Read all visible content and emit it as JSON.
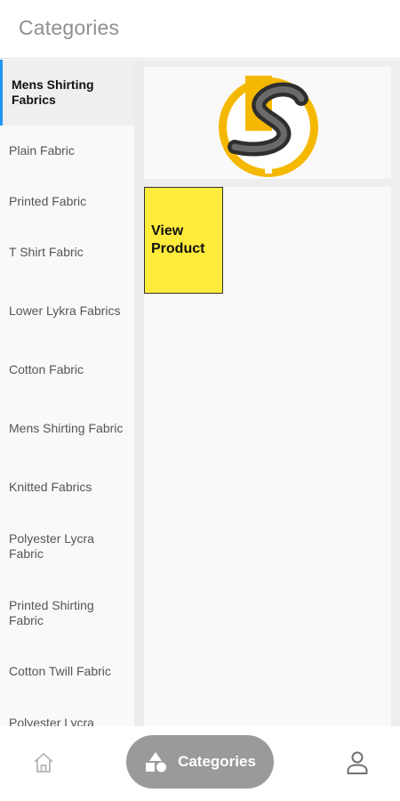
{
  "header": {
    "title": "Categories"
  },
  "sidebar": {
    "items": [
      {
        "label": "Mens Shirting Fabrics",
        "active": true
      },
      {
        "label": "Plain Fabric"
      },
      {
        "label": "Printed Fabric"
      },
      {
        "label": "T Shirt Fabric"
      },
      {
        "label": "Lower Lykra Fabrics"
      },
      {
        "label": "Cotton Fabric"
      },
      {
        "label": "Mens Shirting Fabric"
      },
      {
        "label": "Knitted Fabrics"
      },
      {
        "label": "Polyester Lycra Fabric"
      },
      {
        "label": "Printed Shirting Fabric"
      },
      {
        "label": "Cotton Twill Fabric"
      },
      {
        "label": "Polyester Lycra"
      }
    ]
  },
  "main": {
    "banner": {
      "logo_icon": "s-brand-logo-icon"
    },
    "view_product_label": "View\nProduct"
  },
  "bottom_nav": {
    "home_icon": "home-icon",
    "categories_icon": "categories-shapes-icon",
    "categories_label": "Categories",
    "profile_icon": "profile-icon"
  },
  "colors": {
    "accent": "#2196f3",
    "brand_yellow": "#ffeb3b",
    "logo_yellow": "#f5b800",
    "pill_gray": "#9a9a9a"
  }
}
